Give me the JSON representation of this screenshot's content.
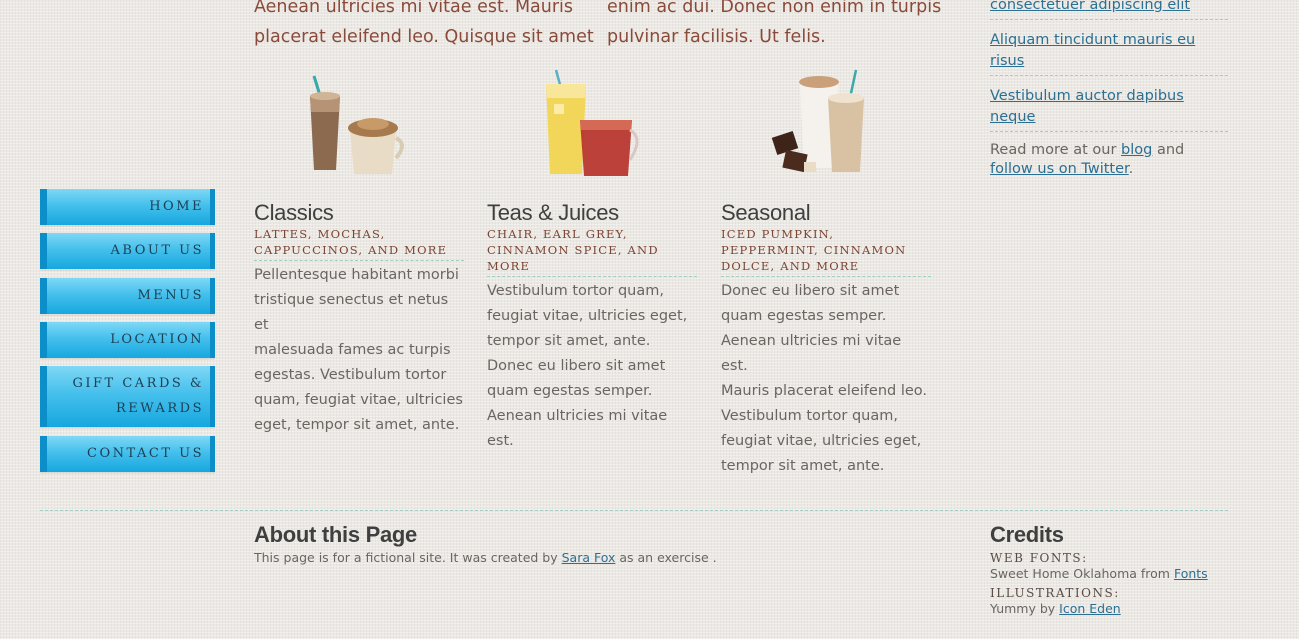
{
  "intro": {
    "col1_line1": "Aenean ultricies mi vitae est. Mauris",
    "col1_line2": "placerat eleifend leo. Quisque sit amet",
    "col2_line1": "enim ac dui. Donec non enim in turpis",
    "col2_line2": "pulvinar facilisis. Ut felis."
  },
  "nav": {
    "items": [
      {
        "label": "HOME"
      },
      {
        "label": "ABOUT US"
      },
      {
        "label": "MENUS"
      },
      {
        "label": "LOCATION"
      },
      {
        "label_line1": "GIFT CARDS &",
        "label_line2": "REWARDS"
      },
      {
        "label": "CONTACT US"
      }
    ]
  },
  "products": [
    {
      "title": "Classics",
      "sub_lines": [
        "LATTES, MOCHAS,",
        "CAPPUCCINOS, AND MORE"
      ],
      "body_lines": [
        "Pellentesque habitant morbi",
        "tristique senectus et netus et",
        "malesuada fames ac turpis",
        "egestas. Vestibulum tortor",
        "quam, feugiat vitae, ultricies",
        "eget, tempor sit amet, ante."
      ]
    },
    {
      "title": "Teas & Juices",
      "sub_lines": [
        "CHAIR, EARL GREY,",
        "CINNAMON SPICE, AND",
        "MORE"
      ],
      "body_lines": [
        "Vestibulum tortor quam,",
        "feugiat vitae, ultricies eget,",
        "tempor sit amet, ante.",
        "Donec eu libero sit amet",
        "quam egestas semper.",
        "Aenean ultricies mi vitae est."
      ]
    },
    {
      "title": "Seasonal",
      "sub_lines": [
        "ICED PUMPKIN,",
        "PEPPERMINT, CINNAMON",
        "DOLCE, AND MORE"
      ],
      "body_lines": [
        "Donec eu libero sit amet",
        "quam egestas semper.",
        "Aenean ultricies mi vitae est.",
        "Mauris placerat eleifend leo.",
        "Vestibulum tortor quam,",
        "feugiat vitae, ultricies eget,",
        "tempor sit amet, ante."
      ]
    }
  ],
  "sidebar": {
    "link_top": "consectetuer adipiscing elit",
    "link_2": "Aliquam tincidunt mauris eu risus",
    "link_3_line1": "Vestibulum auctor dapibus",
    "link_3_line2": "neque",
    "readmore_prefix": "Read more at our ",
    "blog_link": "blog",
    "readmore_and": " and",
    "twitter_link": "follow us on Twitter",
    "period": "."
  },
  "footer": {
    "about_title": "About this Page",
    "about_prefix": "This page is for a fictional site. It was created by ",
    "author_link": "Sara Fox",
    "about_suffix": " as an exercise .",
    "credits_title": "Credits",
    "webfonts_label": "WEB FONTS:",
    "webfonts_text": "Sweet Home Oklahoma from ",
    "fonts_link": "Fonts",
    "illustrations_label": "ILLUSTRATIONS:",
    "illustrations_text": "Yummy by ",
    "icon_eden_link": "Icon Eden"
  },
  "colors": {
    "nav_blue": "#16a7df",
    "link_blue": "#2b6f93",
    "subheading_brown": "#7b4433"
  }
}
